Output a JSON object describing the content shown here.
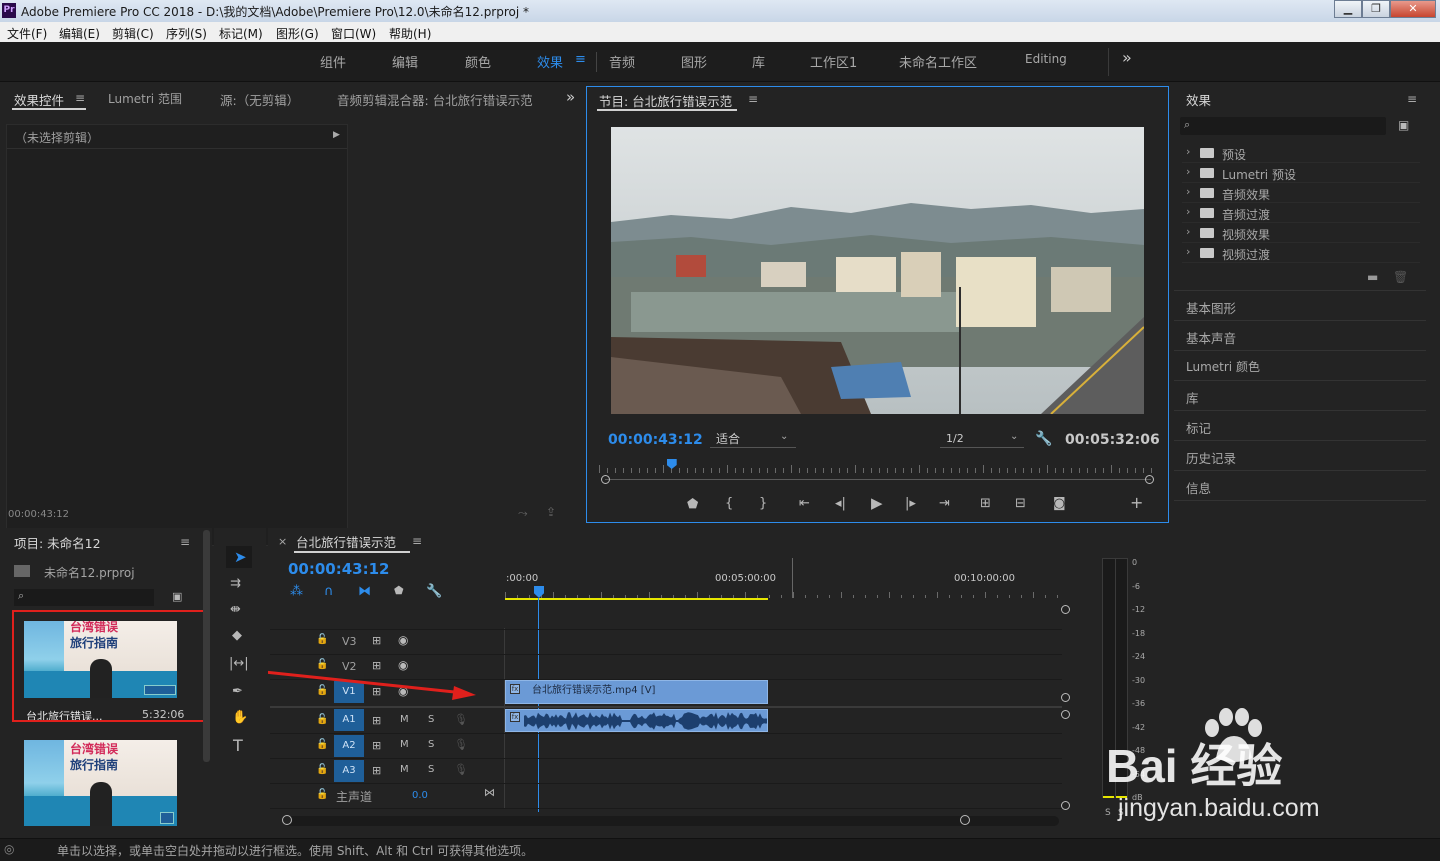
{
  "window": {
    "app_icon": "Pr",
    "title": "Adobe Premiere Pro CC 2018 - D:\\我的文档\\Adobe\\Premiere Pro\\12.0\\未命名12.prproj *",
    "minimize": "▁",
    "maximize": "❐",
    "close": "✕"
  },
  "menu": [
    "文件(F)",
    "编辑(E)",
    "剪辑(C)",
    "序列(S)",
    "标记(M)",
    "图形(G)",
    "窗口(W)",
    "帮助(H)"
  ],
  "workspaces": {
    "items": [
      "组件",
      "编辑",
      "颜色",
      "效果",
      "音频",
      "图形",
      "库",
      "工作区1",
      "未命名工作区",
      "Editing"
    ],
    "active": "效果",
    "more": "»"
  },
  "source_panel": {
    "tabs": [
      "效果控件",
      "Lumetri 范围",
      "源:（无剪辑）",
      "音频剪辑混合器: 台北旅行错误示范"
    ],
    "no_clip": "（未选择剪辑）",
    "timecode": "00:00:43:12",
    "more": "»"
  },
  "program_monitor": {
    "title": "节目: 台北旅行错误示范",
    "timecode": "00:00:43:12",
    "fit": "适合",
    "resolution": "1/2",
    "duration": "00:05:32:06",
    "playhead_fraction": 0.131
  },
  "effects_panel": {
    "title": "效果",
    "items": [
      "预设",
      "Lumetri 预设",
      "音频效果",
      "音频过渡",
      "视频效果",
      "视频过渡"
    ],
    "sections": [
      "基本图形",
      "基本声音",
      "Lumetri 颜色",
      "库",
      "标记",
      "历史记录",
      "信息"
    ]
  },
  "project_panel": {
    "title": "项目: 未命名12",
    "file": "未命名12.prproj",
    "clips": [
      {
        "name": "台北旅行错误...",
        "duration": "5:32:06",
        "overlay_line1": "台湾错误",
        "overlay_line2": "旅行指南"
      },
      {
        "name": "",
        "duration": "",
        "overlay_line1": "台湾错误",
        "overlay_line2": "旅行指南"
      }
    ]
  },
  "timeline": {
    "sequence_name": "台北旅行错误示范",
    "timecode": "00:00:43:12",
    "ruler": [
      ":00:00",
      "00:05:00:00",
      "00:10:00:00"
    ],
    "tracks_video": [
      "V3",
      "V2",
      "V1"
    ],
    "tracks_audio": [
      "A1",
      "A2",
      "A3"
    ],
    "master": "主声道",
    "master_value": "0.0",
    "clip_name": "台北旅行错误示范.mp4 [V]",
    "m_label": "M",
    "s_label": "S"
  },
  "audio_meter": {
    "scale": [
      "0",
      "-6",
      "-12",
      "-18",
      "-24",
      "-30",
      "-36",
      "-42",
      "-48",
      "-54",
      "dB"
    ],
    "channels": [
      "S",
      "S"
    ]
  },
  "status": "单击以选择，或单击空白处并拖动以进行框选。使用 Shift、Alt 和 Ctrl 可获得其他选项。",
  "watermark": {
    "brand": "Bai 经验",
    "url": "jingyan.baidu.com"
  },
  "colors": {
    "accent": "#2d8ceb",
    "highlight_red": "#e0201c",
    "clip_blue": "#6b9ad6"
  }
}
